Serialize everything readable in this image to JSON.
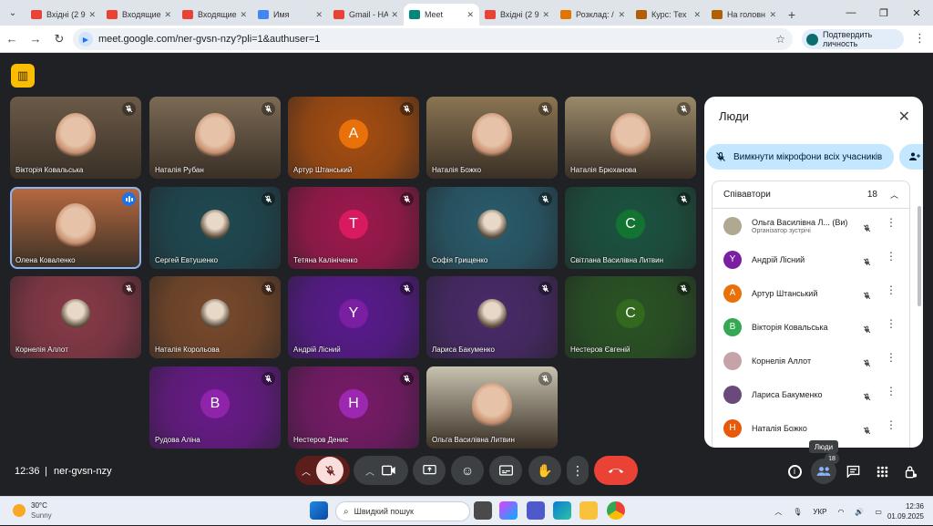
{
  "browser": {
    "tabs": [
      {
        "label": "Вхідні (2 9",
        "icon": "gmail-icon",
        "color": "#ea4335"
      },
      {
        "label": "Входящие",
        "icon": "gmail-icon",
        "color": "#ea4335"
      },
      {
        "label": "Входящие",
        "icon": "gmail-icon",
        "color": "#ea4335"
      },
      {
        "label": "Имя",
        "icon": "google-icon",
        "color": "#4285f4"
      },
      {
        "label": "Gmail - НА",
        "icon": "gmail-icon",
        "color": "#ea4335"
      },
      {
        "label": "Meet",
        "icon": "meet-icon",
        "color": "#00897b",
        "active": true
      },
      {
        "label": "Вхідні (2 9",
        "icon": "gmail-icon",
        "color": "#ea4335"
      },
      {
        "label": "Розклад: /",
        "icon": "schedule-icon",
        "color": "#e37400"
      },
      {
        "label": "Курс: Тех",
        "icon": "course-icon",
        "color": "#b06000"
      },
      {
        "label": "На головн",
        "icon": "course-icon",
        "color": "#b06000"
      }
    ],
    "url": "meet.google.com/ner-gvsn-nzy?pli=1&authuser=1",
    "verify_label": "Подтвердить личность"
  },
  "meet": {
    "logo_icon": "building-icon",
    "tiles": [
      {
        "name": "Вікторія Ковальська",
        "kind": "video",
        "bg": "#6b5a48"
      },
      {
        "name": "Наталія Рубан",
        "kind": "video",
        "bg": "#7b6a55"
      },
      {
        "name": "Артур Штанський",
        "kind": "avatar",
        "letter": "A",
        "bg": "#a84e10",
        "avatar": "#e8710a"
      },
      {
        "name": "Наталія Божко",
        "kind": "video",
        "bg": "#8a7452"
      },
      {
        "name": "Наталія Брюханова",
        "kind": "video",
        "bg": "#9a8a6a"
      },
      {
        "name": "Олена Коваленко",
        "kind": "video",
        "bg": "#b86a40",
        "speaking": true
      },
      {
        "name": "Сергей Евтушенко",
        "kind": "photo",
        "bg": "#1f4a52"
      },
      {
        "name": "Тетяна Калініченко",
        "kind": "avatar",
        "letter": "T",
        "bg": "#a0184e",
        "avatar": "#d81b60"
      },
      {
        "name": "Софія Грищенко",
        "kind": "photo",
        "bg": "#2a5c6c"
      },
      {
        "name": "Світлана Василівна Литвин",
        "kind": "avatar",
        "letter": "C",
        "bg": "#1c5440",
        "avatar": "#137333"
      },
      {
        "name": "Корнелія Аллот",
        "kind": "photo",
        "bg": "#8a3a48"
      },
      {
        "name": "Наталія Корольова",
        "kind": "photo",
        "bg": "#7a4a2a"
      },
      {
        "name": "Андрій Лісний",
        "kind": "avatar",
        "letter": "Y",
        "bg": "#5a1a90",
        "avatar": "#7b1fa2"
      },
      {
        "name": "Лариса Бакуменко",
        "kind": "photo",
        "bg": "#4a2a6a"
      },
      {
        "name": "Нестеров Євгеній",
        "kind": "avatar",
        "letter": "C",
        "bg": "#2a5424",
        "avatar": "#33691e"
      },
      {
        "name": "Рудова Аліна",
        "kind": "avatar",
        "letter": "B",
        "bg": "#6a1a8a",
        "avatar": "#8e24aa"
      },
      {
        "name": "Нестеров Денис",
        "kind": "avatar",
        "letter": "H",
        "bg": "#7a1a6a",
        "avatar": "#9c27b0"
      },
      {
        "name": "Ольга Василівна Литвин",
        "kind": "video",
        "bg": "#c8c2b0"
      }
    ],
    "panel": {
      "title": "Люди",
      "mute_all": "Вимкнути мікрофони всіх учасників",
      "section": "Співавтори",
      "count": "18",
      "people": [
        {
          "name": "Ольга Василівна Л... (Ви)",
          "sub": "Організатор зустрічі",
          "color": "#b0a890",
          "letter": ""
        },
        {
          "name": "Андрій Лісний",
          "sub": "",
          "color": "#7b1fa2",
          "letter": "Y"
        },
        {
          "name": "Артур Штанський",
          "sub": "",
          "color": "#e8710a",
          "letter": "A"
        },
        {
          "name": "Вікторія Ковальська",
          "sub": "",
          "color": "#34a853",
          "letter": "B"
        },
        {
          "name": "Корнелія Аллот",
          "sub": "",
          "color": "#c5a3a8",
          "letter": ""
        },
        {
          "name": "Лариса Бакуменко",
          "sub": "",
          "color": "#6a4a7a",
          "letter": ""
        },
        {
          "name": "Наталія Божко",
          "sub": "",
          "color": "#e8590a",
          "letter": "H"
        }
      ]
    },
    "tooltip": "Люди",
    "people_badge": "18",
    "time": "12:36",
    "separator": "|",
    "meeting_code": "ner-gvsn-nzy",
    "end_color": "#ea4335"
  },
  "taskbar": {
    "temp": "30°C",
    "weather": "Sunny",
    "search": "Швидкий пошук",
    "lang": "УКР",
    "clock_time": "12:36",
    "clock_date": "01.09.2025"
  }
}
